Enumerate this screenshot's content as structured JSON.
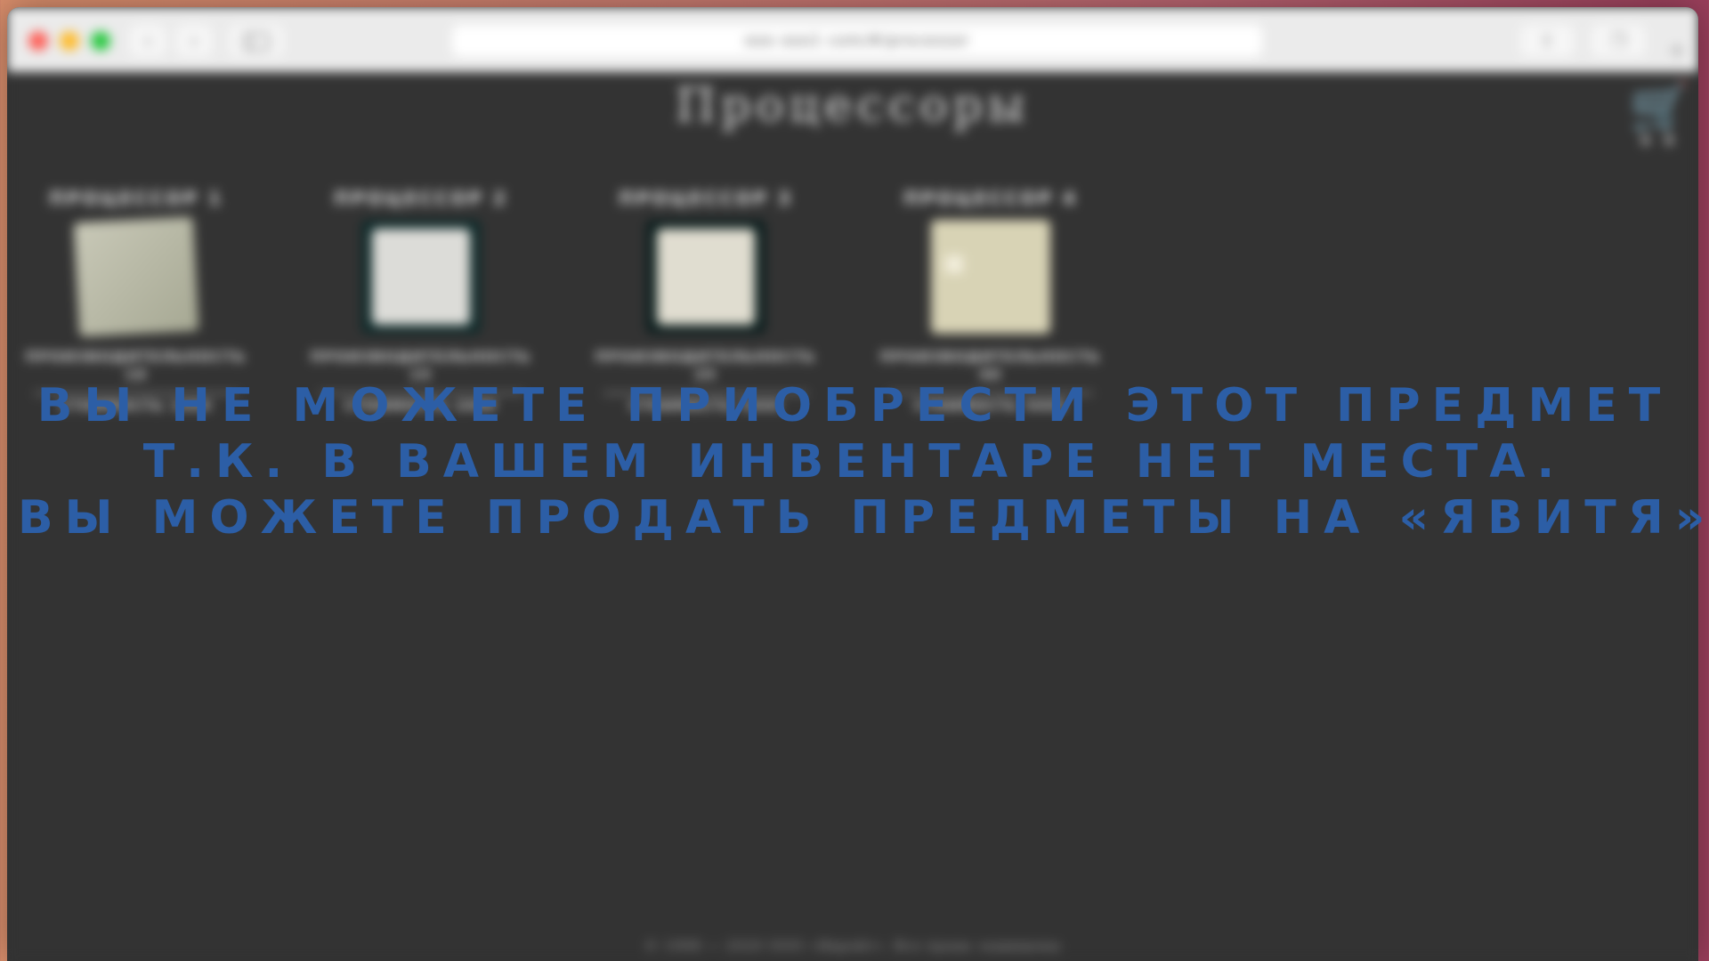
{
  "browser": {
    "address": "ooo ooo1 com/#/processor",
    "back_icon": "chevron-left-icon",
    "forward_icon": "chevron-right-icon",
    "sidebar_icon": "sidebar-icon",
    "share_icon": "share-icon",
    "tabs_icon": "tabs-icon",
    "new_tab_icon": "plus-icon"
  },
  "page": {
    "title": "Процессоры",
    "cart_icon": "cart-icon",
    "cart_count": "0 0",
    "products": [
      {
        "name": "Процессор 1",
        "perf_label": "Производительность",
        "perf_value": "10",
        "price": "Стоимость 1000"
      },
      {
        "name": "Процессор 2",
        "perf_label": "Производительность",
        "perf_value": "15",
        "price": "Стоимость 2000"
      },
      {
        "name": "Процессор 3",
        "perf_label": "Производительность",
        "perf_value": "25",
        "price": "Стоимость 3000"
      },
      {
        "name": "Процессор 4",
        "perf_label": "Производительность",
        "perf_value": "40",
        "price": "Стоимость 5000"
      }
    ],
    "footer": "© 1998 — 2020 ООО «Яврейт». Все права защищены"
  },
  "message": {
    "line1": "Вы не можете приобрести этот предмет",
    "line2": "т.к. в вашем инвентаре нет места.",
    "line3": "Вы можете продать предметы на «Явитя»",
    "color": "#2c5ea6"
  }
}
